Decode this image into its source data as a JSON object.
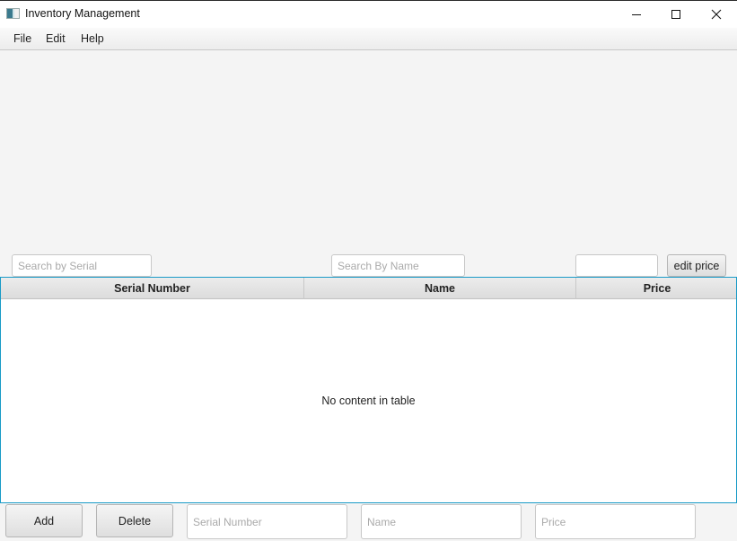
{
  "window": {
    "title": "Inventory Management",
    "controls": {
      "minimize": "—",
      "maximize": "☐",
      "close": "✕"
    }
  },
  "menubar": {
    "items": [
      {
        "label": "File"
      },
      {
        "label": "Edit"
      },
      {
        "label": "Help"
      }
    ]
  },
  "search": {
    "serial_placeholder": "Search by Serial",
    "serial_value": "",
    "name_placeholder": "Search By Name",
    "name_value": "",
    "price_value": "",
    "edit_price_label": "edit price"
  },
  "table": {
    "columns": [
      {
        "label": "Serial Number"
      },
      {
        "label": "Name"
      },
      {
        "label": "Price"
      }
    ],
    "rows": [],
    "empty_message": "No content in table"
  },
  "footer": {
    "add_label": "Add",
    "delete_label": "Delete",
    "serial_placeholder": "Serial Number",
    "name_placeholder": "Name",
    "price_placeholder": "Price"
  },
  "colors": {
    "accent": "#1a9bc7",
    "background": "#f4f4f4"
  }
}
